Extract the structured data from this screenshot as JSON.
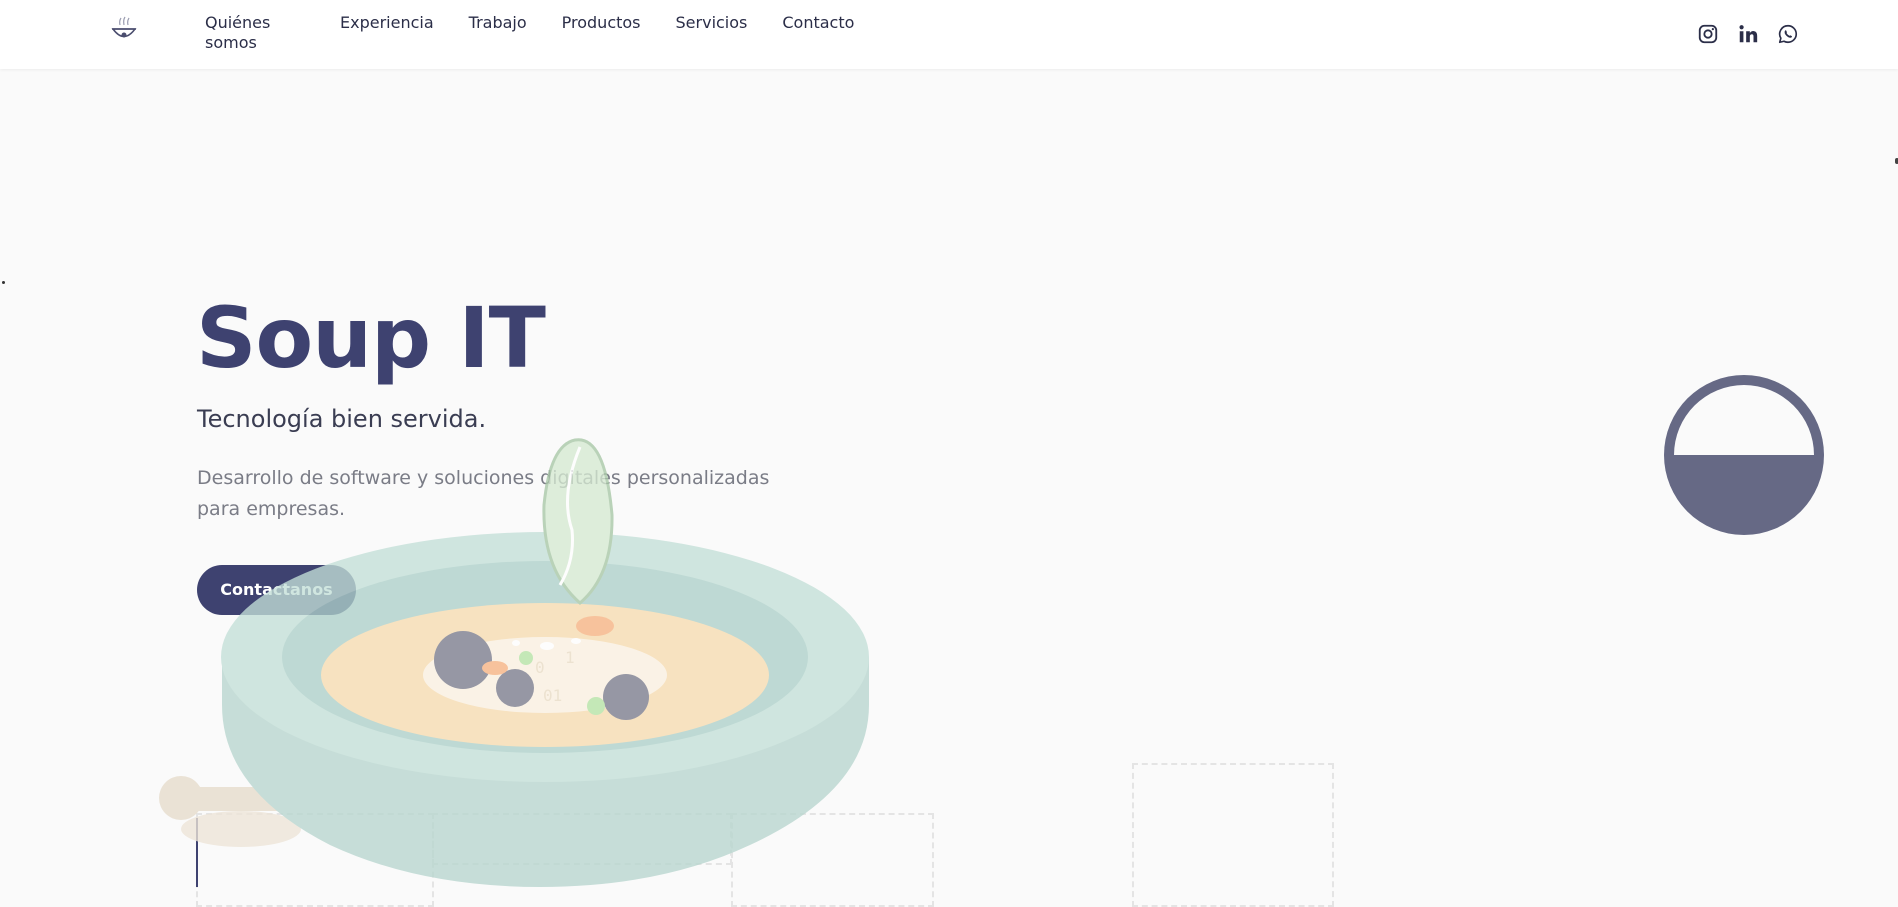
{
  "nav": {
    "links": [
      "Quiénes somos",
      "Experiencia",
      "Trabajo",
      "Productos",
      "Servicios",
      "Contacto"
    ]
  },
  "social": {
    "icons": [
      "instagram-icon",
      "linkedin-icon",
      "whatsapp-icon"
    ]
  },
  "hero": {
    "title": "Soup IT",
    "subtitle": "Tecnología bien servida.",
    "description": "Desarrollo de software y soluciones digitales personalizadas para empresas.",
    "cta_label": "Contactanos"
  },
  "colors": {
    "primary": "#3e4270",
    "background": "#fafafa",
    "bowl": "#c8e0d9",
    "soup": "#f7dcb0",
    "accent_circle": "#666985"
  }
}
